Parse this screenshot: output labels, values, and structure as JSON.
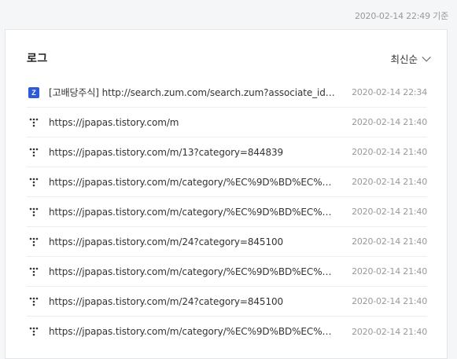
{
  "header": {
    "updated_at": "2020-02-14 22:49 기준"
  },
  "card": {
    "title": "로그",
    "sort_label": "최신순"
  },
  "colors": {
    "zum_brand": "#2c5bd8",
    "muted_text": "#999999"
  },
  "log": {
    "rows": [
      {
        "icon": "zum-icon",
        "url": "[고배당주식] http://search.zum.com/search.zum?associate_id=2…",
        "time": "2020-02-14 22:34"
      },
      {
        "icon": "tistory-icon",
        "url": "https://jpapas.tistory.com/m",
        "time": "2020-02-14 21:40"
      },
      {
        "icon": "tistory-icon",
        "url": "https://jpapas.tistory.com/m/13?category=844839",
        "time": "2020-02-14 21:40"
      },
      {
        "icon": "tistory-icon",
        "url": "https://jpapas.tistory.com/m/category/%EC%9D%BD%EC%9D…",
        "time": "2020-02-14 21:40"
      },
      {
        "icon": "tistory-icon",
        "url": "https://jpapas.tistory.com/m/category/%EC%9D%BD%EC%9D…",
        "time": "2020-02-14 21:40"
      },
      {
        "icon": "tistory-icon",
        "url": "https://jpapas.tistory.com/m/24?category=845100",
        "time": "2020-02-14 21:40"
      },
      {
        "icon": "tistory-icon",
        "url": "https://jpapas.tistory.com/m/category/%EC%9D%BD%EC%9D…",
        "time": "2020-02-14 21:40"
      },
      {
        "icon": "tistory-icon",
        "url": "https://jpapas.tistory.com/m/24?category=845100",
        "time": "2020-02-14 21:40"
      },
      {
        "icon": "tistory-icon",
        "url": "https://jpapas.tistory.com/m/category/%EC%9D%BD%EC%9D…",
        "time": "2020-02-14 21:40"
      }
    ]
  }
}
